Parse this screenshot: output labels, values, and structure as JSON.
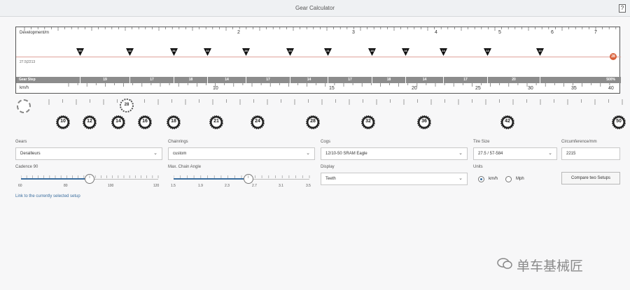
{
  "window": {
    "title": "Gear Calculator",
    "help_label": "?"
  },
  "panel": {
    "dev_label": "Development/m",
    "dev_numbers": [
      "2",
      "3",
      "4",
      "5",
      "6",
      "7"
    ],
    "setup_label": "27.5|2213",
    "gear_markers": [
      "50",
      "42",
      "36",
      "32",
      "28",
      "24",
      "21",
      "18",
      "16",
      "14",
      "12",
      "10"
    ],
    "end_marker": "28",
    "step_title": "Gear Step",
    "steps": [
      "19",
      "17",
      "18",
      "14",
      "17",
      "14",
      "17",
      "18",
      "14",
      "17",
      "20",
      "500%"
    ],
    "kmh_label": "km/h",
    "kmh_numbers": [
      "10",
      "15",
      "20",
      "25",
      "30",
      "35",
      "40"
    ]
  },
  "cogs": {
    "chainring": "28",
    "teeth": [
      "10",
      "12",
      "14",
      "16",
      "18",
      "21",
      "24",
      "28",
      "32",
      "36",
      "42",
      "50"
    ]
  },
  "form": {
    "gears_label": "Gears",
    "gears_value": "Derailleurs",
    "chainrings_label": "Chainrings",
    "chainrings_value": "custom",
    "cogs_label": "Cogs",
    "cogs_value": "12/10-50 SRAM Eagle",
    "tire_label": "Tire Size",
    "tire_value": "27.5 / 57-584",
    "circ_label": "Circumference/mm",
    "circ_value": "2215",
    "cadence_label": "Cadence 90",
    "cadence_scale": [
      "60",
      "80",
      "100",
      "120"
    ],
    "cadence_value": 90,
    "angle_label": "Max. Chain Angle",
    "angle_scale": [
      "1.5",
      "1.9",
      "2.3",
      "2.7",
      "3.1",
      "3.5"
    ],
    "angle_value": 2.6,
    "display_label": "Display",
    "display_value": "Teeth",
    "units_label": "Units",
    "unit_kmh": "km/h",
    "unit_mph": "Mph",
    "compare_label": "Compare two Setups",
    "link_label": "Link to the currently selected setup"
  },
  "watermark": "单车基械匠"
}
